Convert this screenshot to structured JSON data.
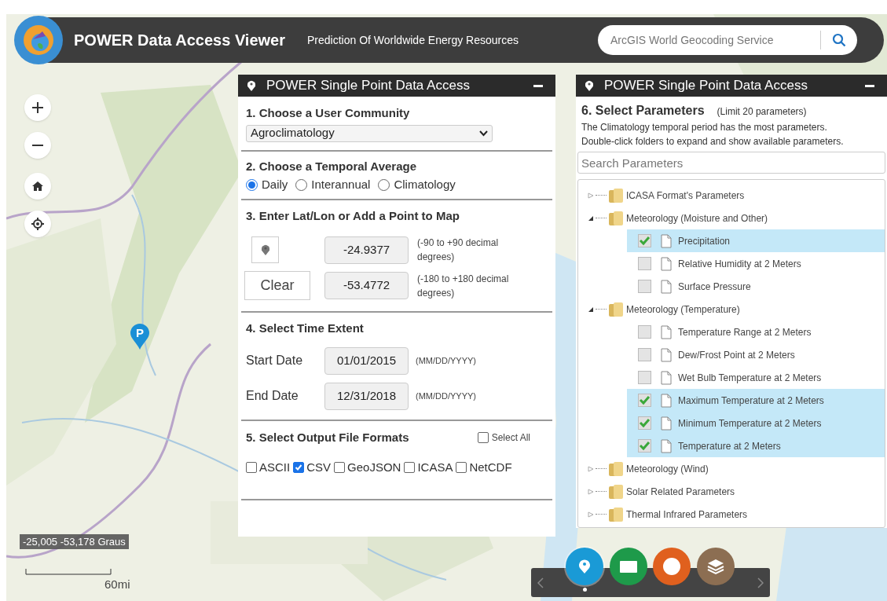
{
  "header": {
    "title": "POWER Data Access Viewer",
    "subtitle": "Prediction Of Worldwide Energy Resources",
    "search": {
      "placeholder": "ArcGIS World Geocoding Service"
    }
  },
  "map": {
    "coordinates": "-25,005 -53,178 Graus",
    "scale": "60mi",
    "marker": "P"
  },
  "left_panel": {
    "title": "POWER Single Point Data Access",
    "community": {
      "heading": "1. Choose a User Community",
      "value": "Agroclimatology"
    },
    "temporal": {
      "heading": "2. Choose a Temporal Average",
      "options": [
        {
          "label": "Daily",
          "selected": true
        },
        {
          "label": "Interannual",
          "selected": false
        },
        {
          "label": "Climatology",
          "selected": false
        }
      ]
    },
    "location": {
      "heading": "3. Enter Lat/Lon or Add a Point to Map",
      "clear": "Clear",
      "lat": "-24.9377",
      "lat_hint": "(-90 to +90 decimal degrees)",
      "lon": "-53.4772",
      "lon_hint": "(-180 to +180 decimal degrees)"
    },
    "time": {
      "heading": "4. Select Time Extent",
      "rows": [
        {
          "label": "Start Date",
          "value": "01/01/2015",
          "hint": "(MM/DD/YYYY)"
        },
        {
          "label": "End Date",
          "value": "12/31/2018",
          "hint": "(MM/DD/YYYY)"
        }
      ]
    },
    "formats": {
      "heading": "5. Select Output File Formats",
      "select_all": {
        "label": "Select All",
        "checked": false
      },
      "options": [
        {
          "label": "ASCII",
          "checked": false
        },
        {
          "label": "CSV",
          "checked": true
        },
        {
          "label": "GeoJSON",
          "checked": false
        },
        {
          "label": "ICASA",
          "checked": false
        },
        {
          "label": "NetCDF",
          "checked": false
        }
      ]
    }
  },
  "right_panel": {
    "title": "POWER Single Point Data Access",
    "heading": "6. Select Parameters",
    "limit": "(Limit 20 parameters)",
    "notes": [
      "The Climatology temporal period has the most parameters.",
      "Double-click folders to expand and show available parameters."
    ],
    "search": {
      "placeholder": "Search Parameters"
    },
    "tree": [
      {
        "label": "ICASA Format's Parameters",
        "expanded": false
      },
      {
        "label": "Meteorology (Moisture and Other)",
        "expanded": true,
        "children": [
          {
            "label": "Precipitation",
            "checked": true
          },
          {
            "label": "Relative Humidity at 2 Meters",
            "checked": false
          },
          {
            "label": "Surface Pressure",
            "checked": false
          }
        ]
      },
      {
        "label": "Meteorology (Temperature)",
        "expanded": true,
        "children": [
          {
            "label": "Temperature Range at 2 Meters",
            "checked": false
          },
          {
            "label": "Dew/Frost Point at 2 Meters",
            "checked": false
          },
          {
            "label": "Wet Bulb Temperature at 2 Meters",
            "checked": false
          },
          {
            "label": "Maximum Temperature at 2 Meters",
            "checked": true
          },
          {
            "label": "Minimum Temperature at 2 Meters",
            "checked": true
          },
          {
            "label": "Temperature at 2 Meters",
            "checked": true
          }
        ]
      },
      {
        "label": "Meteorology (Wind)",
        "expanded": false
      },
      {
        "label": "Solar Related Parameters",
        "expanded": false
      },
      {
        "label": "Thermal Infrared Parameters",
        "expanded": false
      }
    ]
  },
  "toolbar": {
    "tools": [
      {
        "kind": "point",
        "selected": true
      },
      {
        "kind": "region",
        "selected": false
      },
      {
        "kind": "global",
        "selected": false
      },
      {
        "kind": "layers",
        "selected": false
      }
    ]
  }
}
